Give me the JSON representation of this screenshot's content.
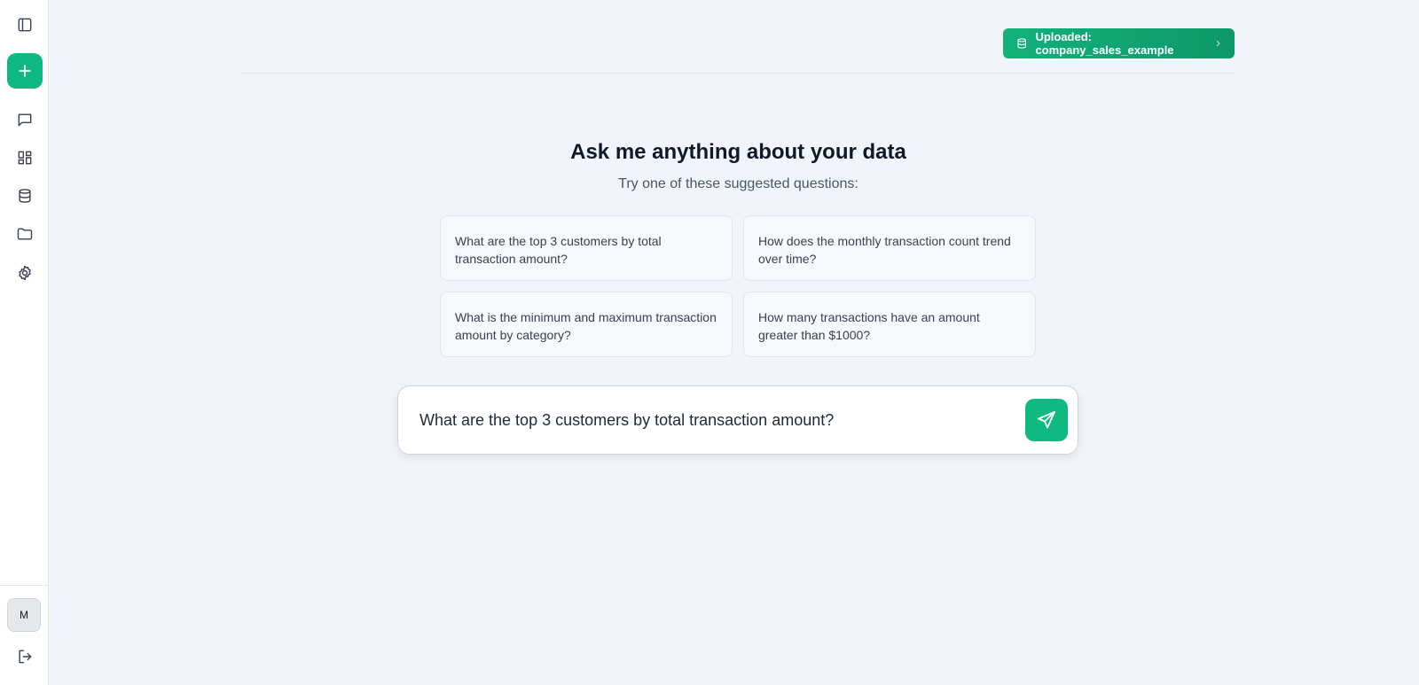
{
  "sidebar": {
    "toggle_icon": "sidebar-toggle-icon",
    "new_icon": "plus-icon",
    "items": [
      {
        "name": "chat",
        "icon": "chat-bubble-icon"
      },
      {
        "name": "dashboard",
        "icon": "dashboard-grid-icon"
      },
      {
        "name": "database",
        "icon": "database-icon"
      },
      {
        "name": "files",
        "icon": "folder-icon"
      },
      {
        "name": "settings",
        "icon": "gear-icon"
      }
    ],
    "avatar_initial": "M",
    "logout_icon": "logout-icon"
  },
  "header": {
    "upload_label": "Uploaded: company_sales_example"
  },
  "main": {
    "title": "Ask me anything about your data",
    "subtitle": "Try one of these suggested questions:",
    "suggestions": [
      "What are the top 3 customers by total transaction amount?",
      "How does the monthly transaction count trend over time?",
      "What is the minimum and maximum transaction amount by category?",
      "How many transactions have an amount greater than $1000?"
    ]
  },
  "input": {
    "value": "What are the top 3 customers by total transaction amount?"
  },
  "colors": {
    "accent": "#10b981",
    "background": "#f1f5fb"
  }
}
